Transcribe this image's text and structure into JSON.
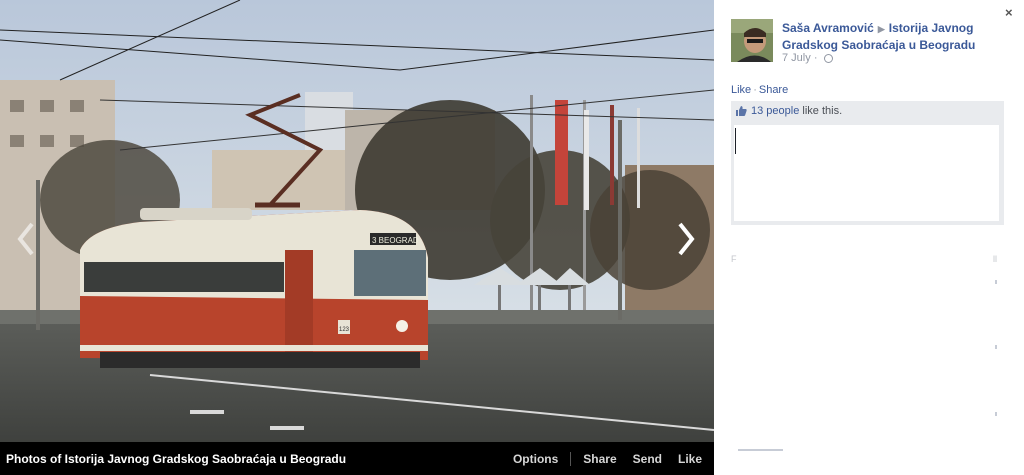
{
  "photo": {
    "destination_sign": "3 BEOGRAD",
    "tram_number": "123"
  },
  "bottombar": {
    "album_title": "Photos of Istorija Javnog Gradskog Saobraćaja u Beogradu",
    "options": "Options",
    "share": "Share",
    "send": "Send",
    "like": "Like"
  },
  "sidebar": {
    "close": "×",
    "author": "Saša Avramović",
    "separator": "▶",
    "page_name": "Istorija Javnog Gradskog Saobraćaja u Beogradu",
    "date": "7 July",
    "like_link": "Like",
    "dot": "·",
    "share_link": "Share",
    "likes_count": "13 people",
    "likes_suffix": " like this.",
    "frag_f": "F",
    "frag_ll": "ll"
  },
  "colors": {
    "link": "#3b5998",
    "likes_bg": "#e9ebee",
    "tram_red": "#b8442c",
    "tram_cream": "#e8e4d6"
  },
  "icons": [
    "close-icon",
    "globe-icon",
    "thumbs-up-icon",
    "chevron-left-icon",
    "chevron-right-icon",
    "expand-icon"
  ]
}
